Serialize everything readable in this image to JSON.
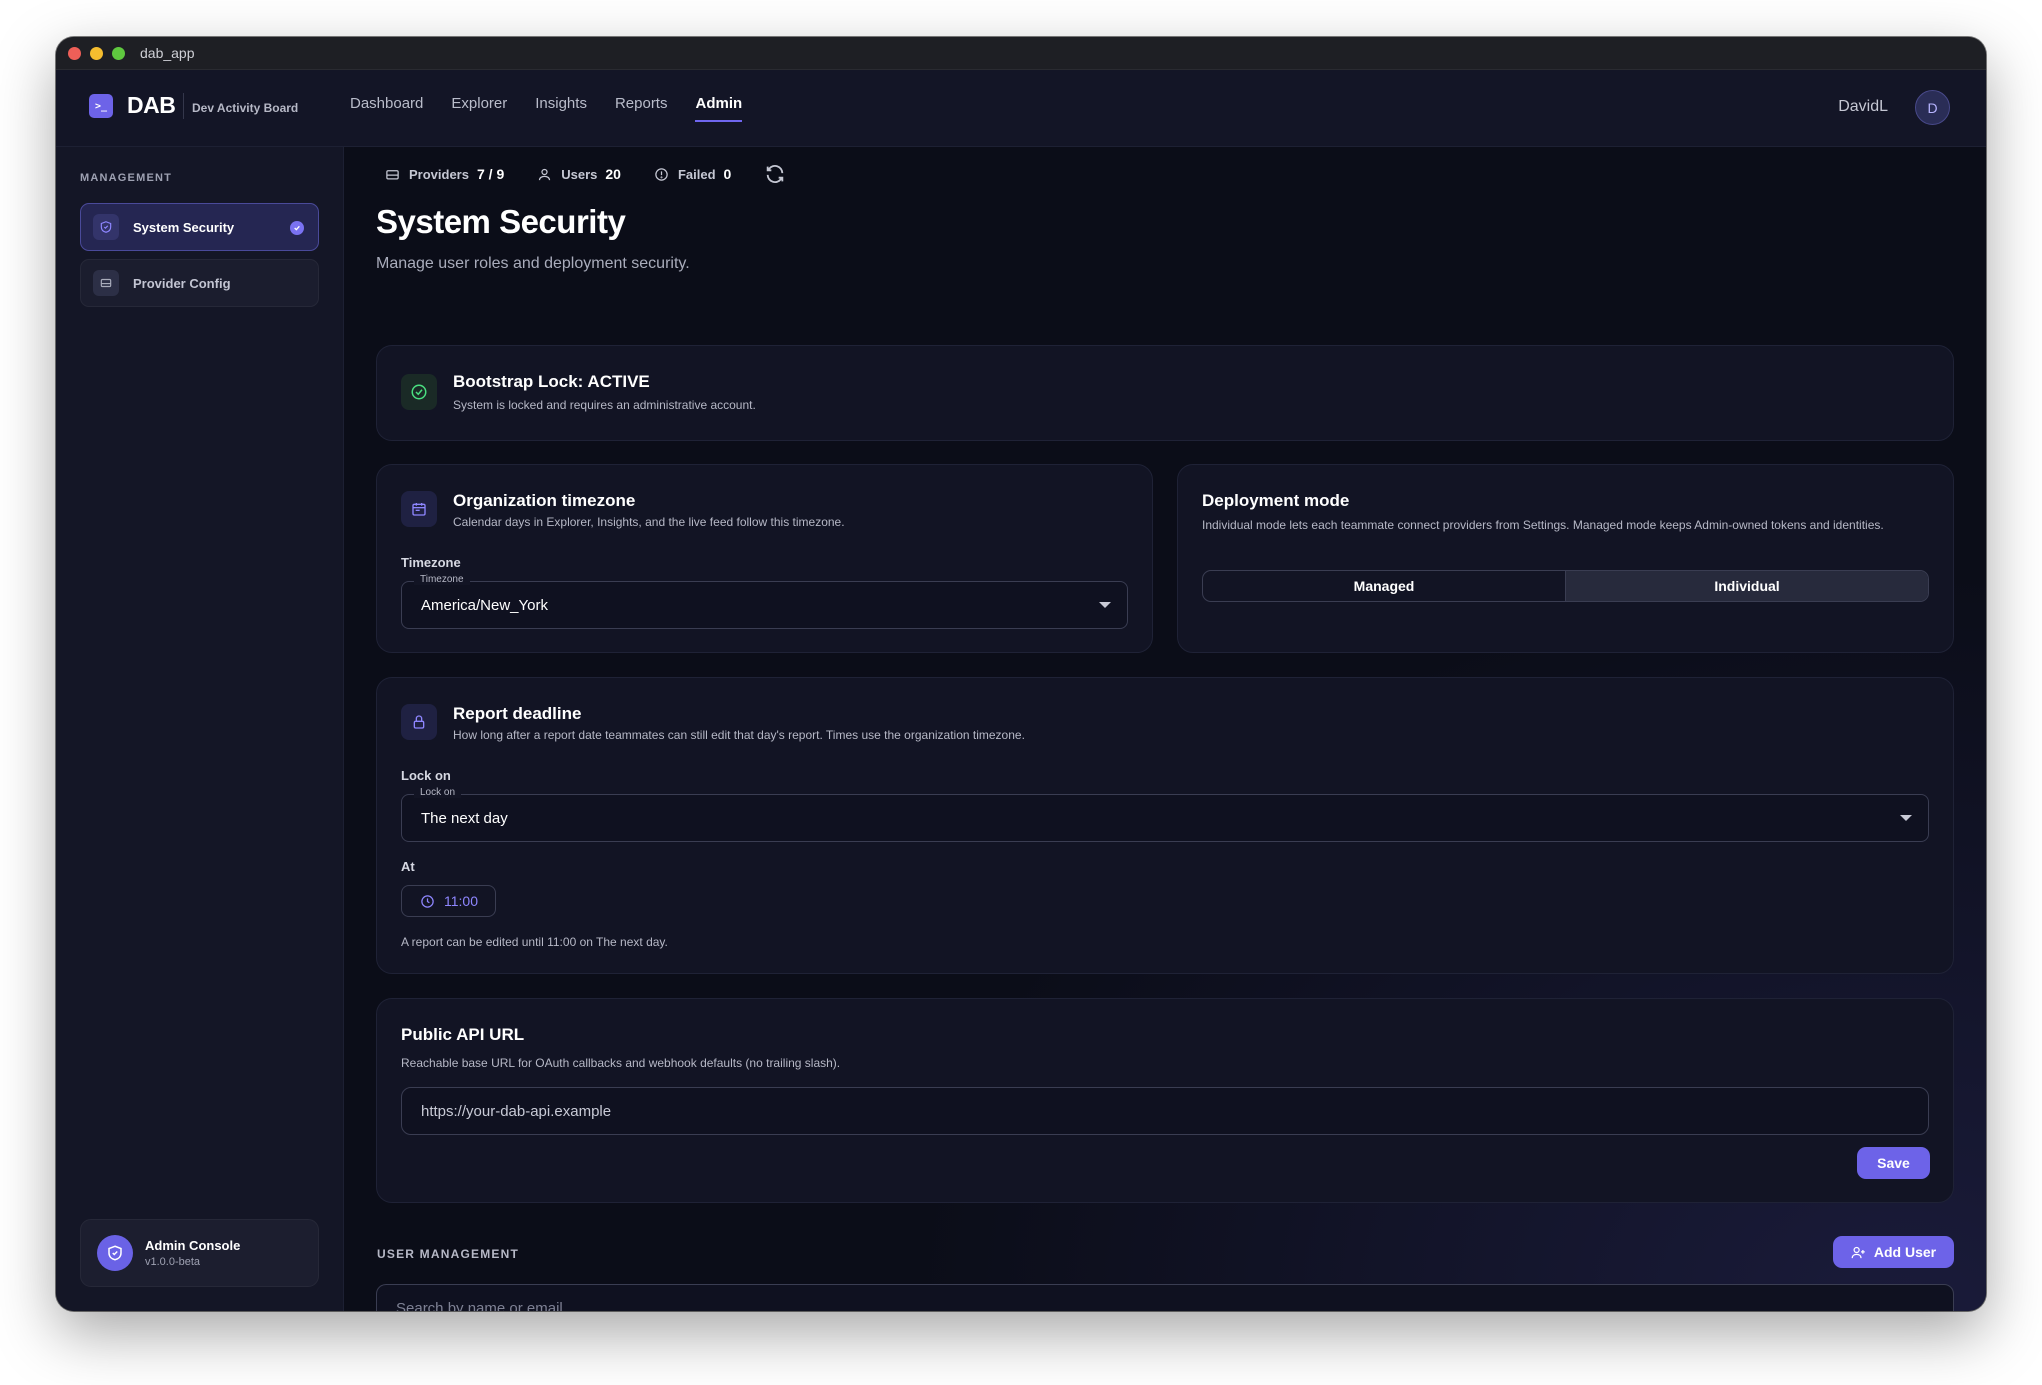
{
  "window": {
    "title": "dab_app"
  },
  "brand": {
    "logo": "DAB",
    "subtitle": "Dev Activity Board",
    "icon": "terminal-icon"
  },
  "nav": {
    "links": [
      {
        "label": "Dashboard"
      },
      {
        "label": "Explorer"
      },
      {
        "label": "Insights"
      },
      {
        "label": "Reports"
      },
      {
        "label": "Admin"
      }
    ],
    "active": "Admin"
  },
  "user": {
    "name": "DavidL",
    "initial": "D"
  },
  "sidebar": {
    "heading": "MANAGEMENT",
    "items": [
      {
        "label": "System Security",
        "icon": "shield-icon",
        "active": true
      },
      {
        "label": "Provider Config",
        "icon": "server-icon",
        "active": false
      }
    ],
    "console": {
      "title": "Admin Console",
      "version": "v1.0.0-beta"
    }
  },
  "stats": {
    "providers_label": "Providers",
    "providers_value": "7 / 9",
    "users_label": "Users",
    "users_value": "20",
    "failed_label": "Failed",
    "failed_value": "0"
  },
  "page": {
    "title": "System Security",
    "subtitle": "Manage user roles and deployment security."
  },
  "bootstrap": {
    "title": "Bootstrap Lock: ACTIVE",
    "description": "System is locked and requires an administrative account."
  },
  "timezone": {
    "title": "Organization timezone",
    "description": "Calendar days in Explorer, Insights, and the live feed follow this timezone.",
    "label": "Timezone",
    "legend": "Timezone",
    "value": "America/New_York"
  },
  "deployment": {
    "title": "Deployment mode",
    "description": "Individual mode lets each teammate connect providers from Settings. Managed mode keeps Admin-owned tokens and identities.",
    "options": [
      "Managed",
      "Individual"
    ],
    "selected": "Individual"
  },
  "deadline": {
    "title": "Report deadline",
    "description": "How long after a report date teammates can still edit that day's report. Times use the organization timezone.",
    "lock_label": "Lock on",
    "lock_legend": "Lock on",
    "lock_value": "The next day",
    "at_label": "At",
    "time": "11:00",
    "hint": "A report can be edited until 11:00 on The next day."
  },
  "api": {
    "title": "Public API URL",
    "description": "Reachable base URL for OAuth callbacks and webhook defaults (no trailing slash).",
    "placeholder": "https://your-dab-api.example",
    "save_label": "Save"
  },
  "users": {
    "heading": "USER MANAGEMENT",
    "add_label": "Add User",
    "search_placeholder": "Search by name or email"
  },
  "colors": {
    "accent": "#6d63e8",
    "success": "#4ade80",
    "background": "#0b0d18"
  }
}
